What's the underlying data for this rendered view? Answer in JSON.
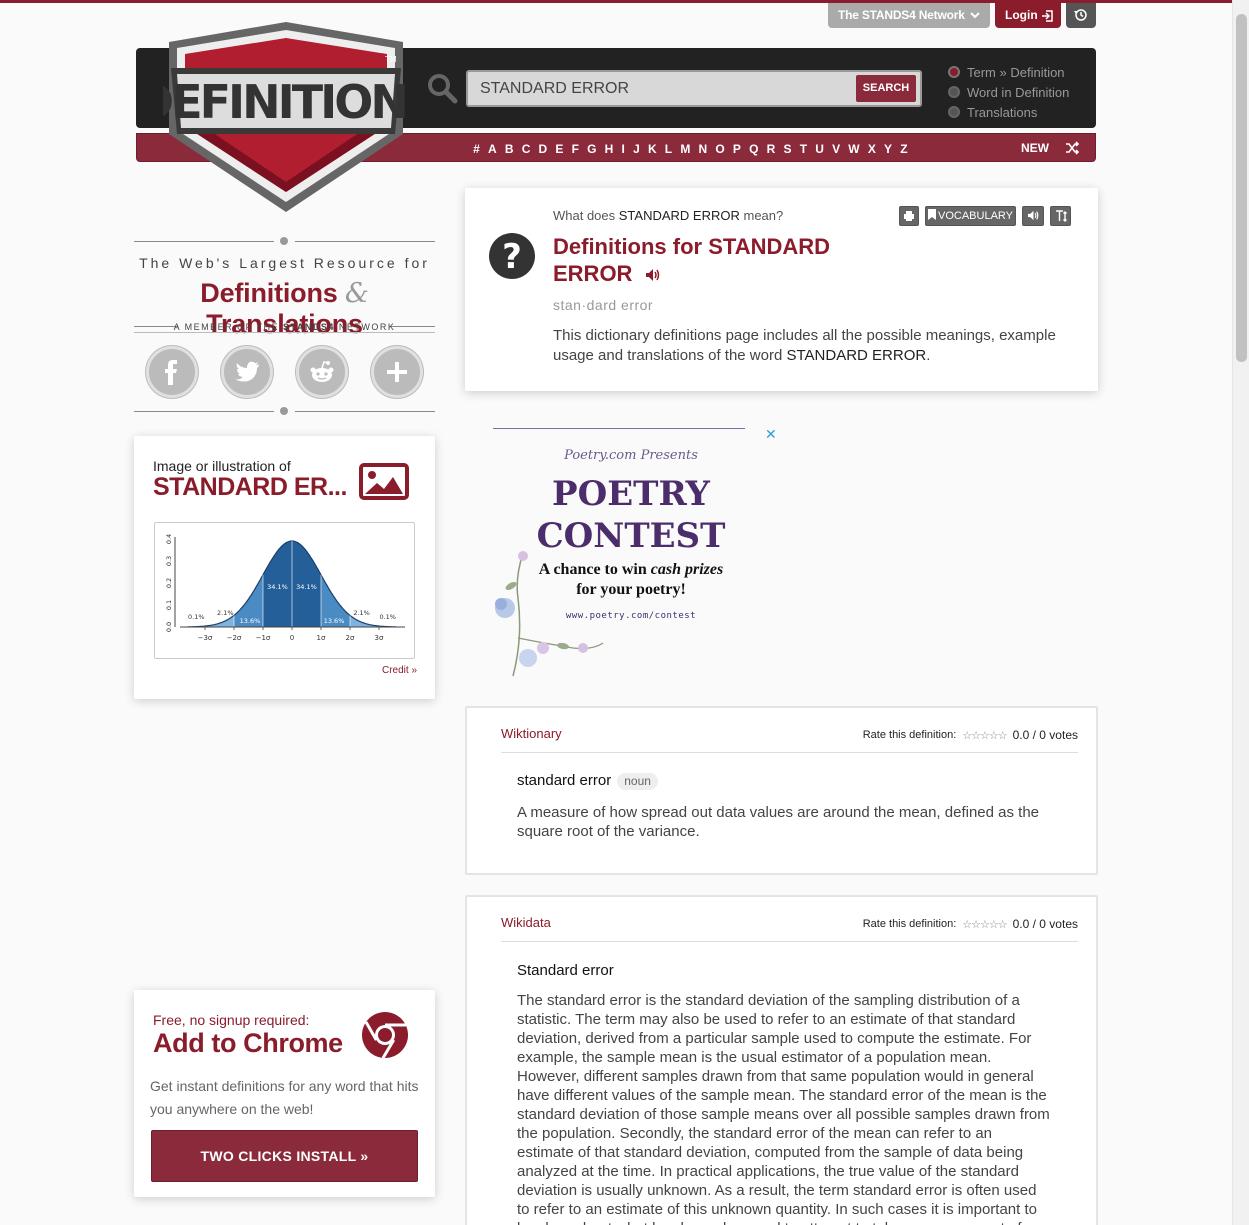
{
  "topbar": {
    "network_label": "The STANDS4 Network",
    "login_label": "Login"
  },
  "header": {
    "logo_text": "DEFINITIONS",
    "search": {
      "value": "STANDARD ERROR",
      "button_label": "SEARCH"
    },
    "search_modes": [
      {
        "label": "Term » Definition",
        "selected": true
      },
      {
        "label": "Word in Definition",
        "selected": false
      },
      {
        "label": "Translations",
        "selected": false
      }
    ],
    "alphabet": [
      "#",
      "A",
      "B",
      "C",
      "D",
      "E",
      "F",
      "G",
      "H",
      "I",
      "J",
      "K",
      "L",
      "M",
      "N",
      "O",
      "P",
      "Q",
      "R",
      "S",
      "T",
      "U",
      "V",
      "W",
      "X",
      "Y",
      "Z"
    ],
    "new_label": "NEW"
  },
  "sidebar": {
    "tagline_line1": "The Web's Largest Resource for",
    "tagline_main_a": "Definitions ",
    "tagline_amp": "&",
    "tagline_main_b": " Translations",
    "member_prefix": "A MEMBER OF THE ",
    "member_brand": "STANDS4",
    "member_suffix": " NETWORK",
    "social": [
      "facebook-icon",
      "twitter-icon",
      "reddit-icon",
      "plus-icon"
    ],
    "image_card": {
      "label": "Image or illustration of",
      "word": "STANDARD ER...",
      "credit": "Credit »"
    },
    "chrome_card": {
      "free_label": "Free, no signup required:",
      "title": "Add to Chrome",
      "description": "Get instant definitions for any word that hits you anywhere on the web!",
      "button_label": "TWO CLICKS INSTALL »"
    }
  },
  "main": {
    "question_prefix": "What does ",
    "question_term": "STANDARD ERROR",
    "question_suffix": " mean?",
    "title": "Definitions for STANDARD ERROR",
    "pronunciation": "stan·dard error",
    "description_prefix": "This dictionary definitions page includes all the possible meanings, example usage and translations of the word ",
    "description_term": "STANDARD ERROR",
    "description_suffix": ".",
    "tools": {
      "vocabulary_label": "VOCABULARY"
    }
  },
  "ad": {
    "presenter": "Poetry.com Presents",
    "headline_1": "POETRY",
    "headline_2": "CONTEST",
    "sub_1": "A chance to win ",
    "sub_em": "cash prizes",
    "sub_2": "for your poetry!",
    "url": "www.poetry.com/contest"
  },
  "definitions": [
    {
      "source": "Wiktionary",
      "rate_label": "Rate this definition:",
      "score": "0.0",
      "votes": "0 votes",
      "term": "standard error",
      "pos": "noun",
      "text": "A measure of how spread out data values are around the mean, defined as the square root of the variance."
    },
    {
      "source": "Wikidata",
      "rate_label": "Rate this definition:",
      "score": "0.0",
      "votes": "0 votes",
      "term": "Standard error",
      "text": "The standard error is the standard deviation of the sampling distribution of a statistic. The term may also be used to refer to an estimate of that standard deviation, derived from a particular sample used to compute the estimate. For example, the sample mean is the usual estimator of a population mean. However, different samples drawn from that same population would in general have different values of the sample mean. The standard error of the mean is the standard deviation of those sample means over all possible samples drawn from the population. Secondly, the standard error of the mean can refer to an estimate of that standard deviation, computed from the sample of data being analyzed at the time. In practical applications, the true value of the standard deviation is usually unknown. As a result, the term standard error is often used to refer to an estimate of this unknown quantity. In such cases it is important to be clear about what has been done and to attempt to take proper account of"
    }
  ],
  "illustration": {
    "y_ticks": [
      "0.0",
      "0.1",
      "0.2",
      "0.3",
      "0.4"
    ],
    "x_ticks": [
      "−3σ",
      "−2σ",
      "−1σ",
      "0",
      "1σ",
      "2σ",
      "3σ"
    ],
    "percent_labels": [
      "0.1%",
      "2.1%",
      "13.6%",
      "34.1%",
      "34.1%",
      "13.6%",
      "2.1%",
      "0.1%"
    ]
  },
  "colors": {
    "brand": "#8a1c2b",
    "header": "#222222"
  }
}
